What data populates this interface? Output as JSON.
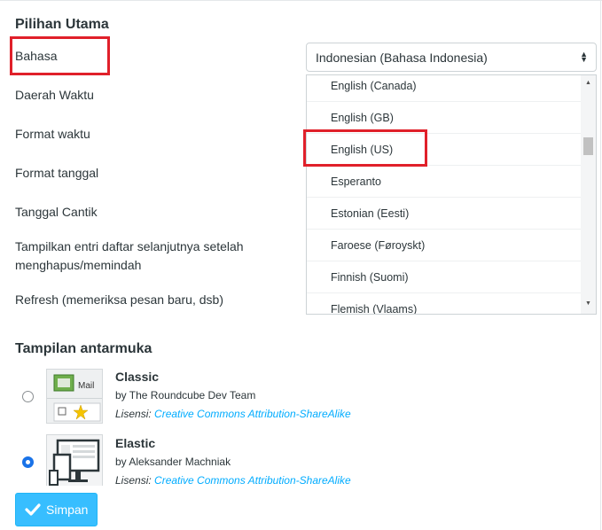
{
  "main_section": {
    "title": "Pilihan Utama"
  },
  "settings": {
    "language_label": "Bahasa",
    "timezone_label": "Daerah Waktu",
    "time_format_label": "Format waktu",
    "date_format_label": "Format tanggal",
    "pretty_date_label": "Tanggal Cantik",
    "show_next_label": "Tampilkan entri daftar selanjutnya setelah menghapus/memindah",
    "refresh_label": "Refresh (memeriksa pesan baru, dsb)"
  },
  "language_select": {
    "selected": "Indonesian (Bahasa Indonesia)",
    "options": [
      "English (Canada)",
      "English (GB)",
      "English (US)",
      "Esperanto",
      "Estonian (Eesti)",
      "Faroese (Føroyskt)",
      "Finnish (Suomi)",
      "Flemish (Vlaams)"
    ],
    "highlighted_option": "English (US)"
  },
  "interface_section": {
    "title": "Tampilan antarmuka"
  },
  "skins": [
    {
      "name": "Classic",
      "author": "by The Roundcube Dev Team",
      "license_prefix": "Lisensi:",
      "license_link": "Creative Commons Attribution-ShareAlike",
      "thumb_text": "Mail",
      "selected": false
    },
    {
      "name": "Elastic",
      "author": "by Aleksander Machniak",
      "license_prefix": "Lisensi:",
      "license_link": "Creative Commons Attribution-ShareAlike",
      "selected": true
    }
  ],
  "save_button": {
    "label": "Simpan"
  },
  "colors": {
    "highlight": "#e0202a",
    "link": "#00acff",
    "button": "#37beff"
  }
}
